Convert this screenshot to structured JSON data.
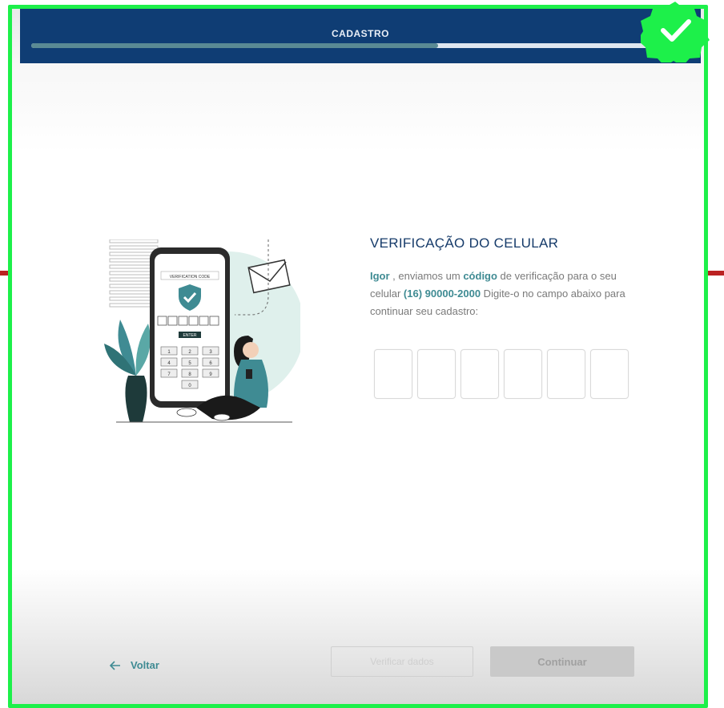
{
  "header": {
    "title": "CADASTRO",
    "progress": 0.62
  },
  "verification": {
    "title": "VERIFICAÇÃO DO CELULAR",
    "name": "Igor",
    "text_1": " , enviamos um ",
    "code_word": "código",
    "text_2": " de verificação para o seu celular ",
    "phone": "(16) 90000-2000",
    "text_3": " Digite-o no campo abaixo para continuar seu cadastro:",
    "code_digits": [
      "",
      "",
      "",
      "",
      "",
      ""
    ]
  },
  "illustration": {
    "screen_label": "VERIFICATION CODE",
    "button_label": "ENTER",
    "keys": [
      "1",
      "2",
      "3",
      "4",
      "5",
      "6",
      "7",
      "8",
      "9",
      "0"
    ]
  },
  "footer": {
    "back_label": "Voltar",
    "verify_label": "Verificar dados",
    "continue_label": "Continuar"
  },
  "colors": {
    "header": "#0f3d74",
    "accent": "#3f8b93",
    "frame": "#1df04a"
  },
  "icons": [
    "arrow-left-icon",
    "check-badge-icon",
    "shield-check-icon",
    "envelope-icon"
  ]
}
